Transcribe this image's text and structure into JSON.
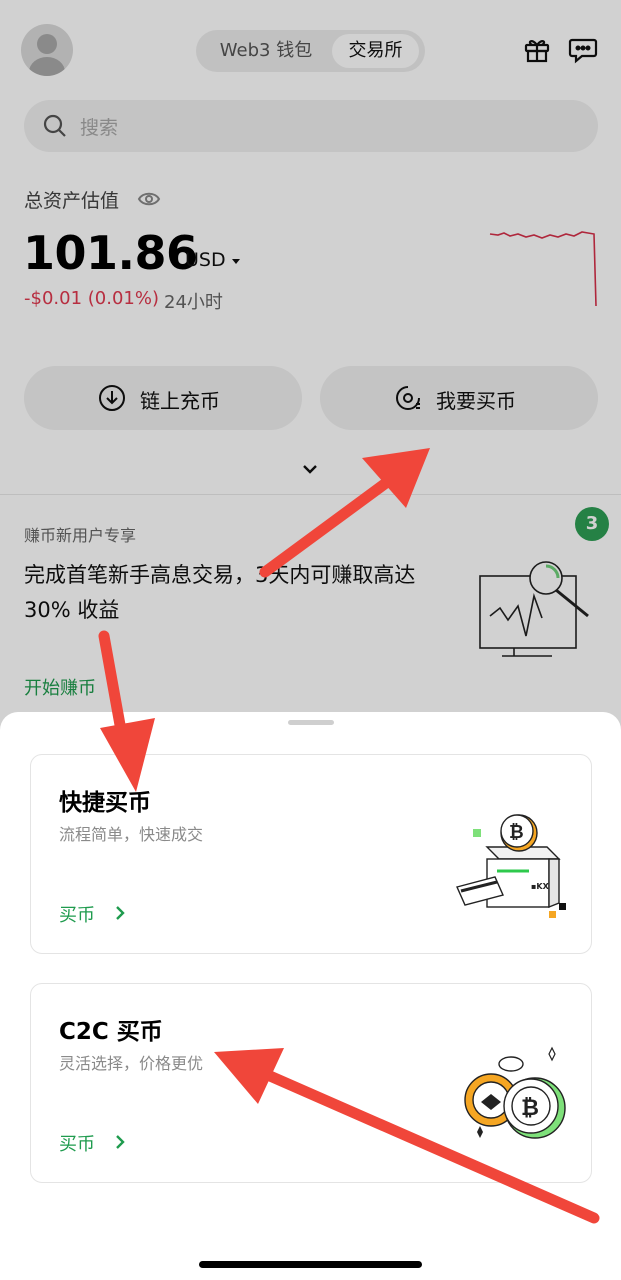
{
  "header": {
    "segments": [
      "Web3 钱包",
      "交易所"
    ],
    "active_segment": "交易所",
    "gift_icon": "gift-icon",
    "message_icon": "chat-icon"
  },
  "search": {
    "placeholder": "搜索"
  },
  "assets": {
    "label": "总资产估值",
    "value": "101.86",
    "unit": "USD",
    "change": "-$0.01 (0.01%)",
    "period": "24小时"
  },
  "actions": {
    "deposit": "链上充币",
    "buy": "我要买币"
  },
  "promo": {
    "label": "赚币新用户专享",
    "title": "完成首笔新手高息交易，3天内可赚取高达 30% 收益",
    "link": "开始赚币",
    "badge": "3"
  },
  "sheet": {
    "options": [
      {
        "title": "快捷买币",
        "subtitle": "流程简单，快速成交",
        "action": "买币"
      },
      {
        "title": "C2C 买币",
        "subtitle": "灵活选择，价格更优",
        "action": "买币"
      }
    ]
  },
  "colors": {
    "accent_green": "#1f9b4e",
    "negative_red": "#e0394f",
    "arrow_red": "#f0463a"
  }
}
